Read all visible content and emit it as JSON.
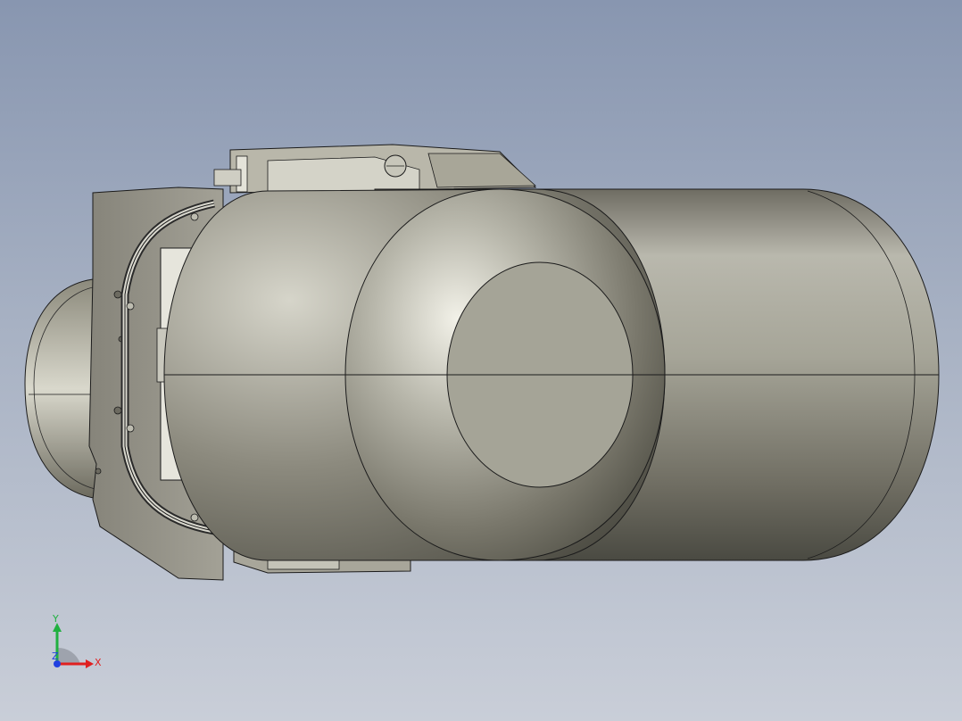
{
  "viewport": {
    "background_top": "#8896b0",
    "background_bottom": "#c9ced8"
  },
  "model": {
    "name": "",
    "body_color": "#9a9888",
    "outline_color": "#1b1b1b"
  },
  "triad": {
    "x_label": "X",
    "y_label": "Y",
    "z_label": "Z",
    "x_color": "#e02020",
    "y_color": "#20b040",
    "z_color": "#2040e0"
  }
}
